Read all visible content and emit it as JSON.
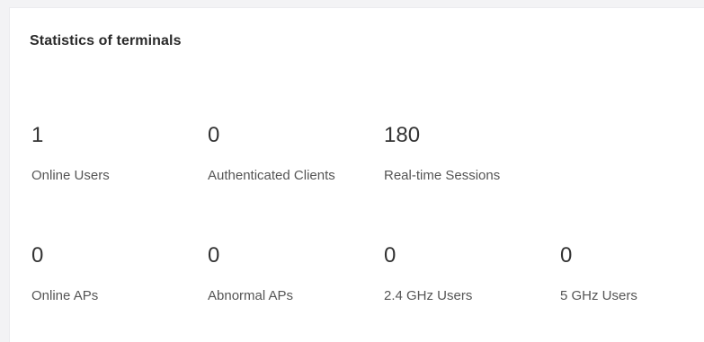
{
  "card": {
    "title": "Statistics of terminals"
  },
  "stats": [
    {
      "value": "1",
      "label": "Online Users"
    },
    {
      "value": "0",
      "label": "Authenticated Clients"
    },
    {
      "value": "180",
      "label": "Real-time Sessions"
    },
    {
      "value": "0",
      "label": "Online APs"
    },
    {
      "value": "0",
      "label": "Abnormal APs"
    },
    {
      "value": "0",
      "label": "2.4 GHz Users"
    },
    {
      "value": "0",
      "label": "5 GHz Users"
    }
  ]
}
